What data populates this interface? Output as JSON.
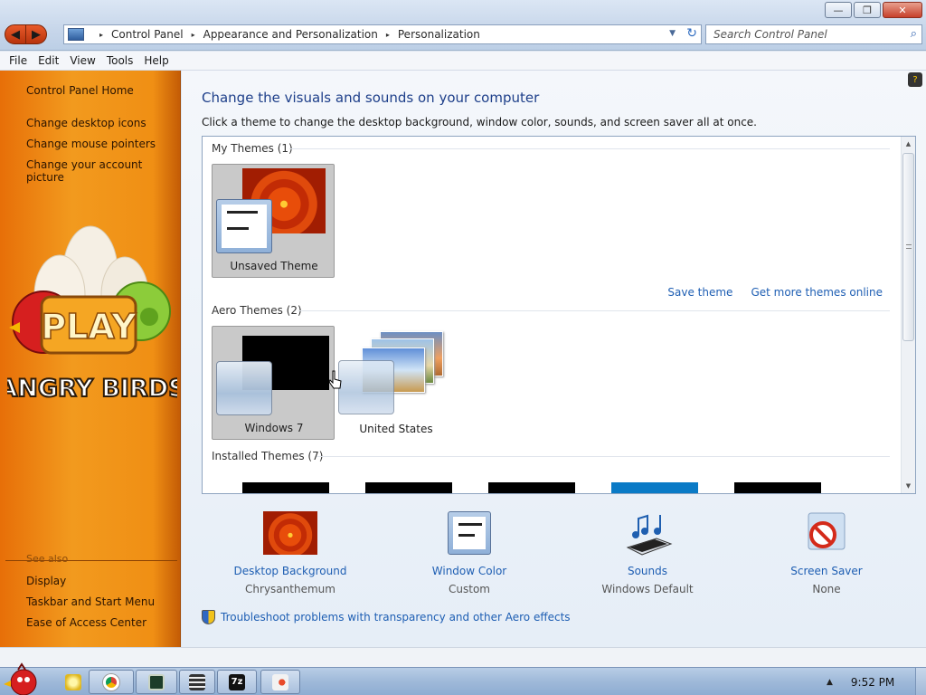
{
  "window": {
    "minimize_glyph": "—",
    "maximize_glyph": "❐",
    "close_glyph": "✕"
  },
  "nav": {
    "back_glyph": "◀",
    "forward_glyph": "▶"
  },
  "address": {
    "crumbs": [
      "Control Panel",
      "Appearance and Personalization",
      "Personalization"
    ],
    "separator": "▸",
    "dropdown_glyph": "▼",
    "refresh_glyph": "↻"
  },
  "search": {
    "placeholder": "Search Control Panel",
    "icon_glyph": "⌕"
  },
  "menu": {
    "items": [
      "File",
      "Edit",
      "View",
      "Tools",
      "Help"
    ]
  },
  "sidebar": {
    "links": [
      "Control Panel Home",
      "Change desktop icons",
      "Change mouse pointers",
      "Change your account picture"
    ],
    "see_also": "See also",
    "see_also_links": [
      "Display",
      "Taskbar and Start Menu",
      "Ease of Access Center"
    ],
    "art": {
      "play_text": "PLAY",
      "logo_text": "ANGRY BIRDS"
    }
  },
  "main": {
    "title": "Change the visuals and sounds on your computer",
    "description": "Click a theme to change the desktop background, window color, sounds, and screen saver all at once.",
    "help_glyph": "?",
    "groups": {
      "my_themes": "My Themes (1)",
      "aero_themes": "Aero Themes (2)",
      "installed_themes": "Installed Themes (7)"
    },
    "themes": {
      "unsaved": "Unsaved Theme",
      "windows7": "Windows 7",
      "united_states": "United States"
    },
    "links": {
      "save_theme": "Save theme",
      "get_more": "Get more themes online"
    },
    "settings": [
      {
        "name": "Desktop Background",
        "value": "Chrysanthemum"
      },
      {
        "name": "Window Color",
        "value": "Custom"
      },
      {
        "name": "Sounds",
        "value": "Windows Default"
      },
      {
        "name": "Screen Saver",
        "value": "None"
      }
    ],
    "troubleshoot": "Troubleshoot problems with transparency and other Aero effects",
    "colors": {
      "accent_link": "#1e5eb3",
      "sidebar_orange": "#f29a1e",
      "installed_strip_blue": "#0a7ac6"
    }
  },
  "taskbar": {
    "items": [
      "angry-birds-start-icon",
      "folder-icon",
      "chrome-icon",
      "monitor-app-icon",
      "calculator-icon",
      "7zip-icon",
      "paint-icon"
    ],
    "tray_arrow": "▲",
    "clock": "9:52 PM",
    "seven_zip_label": "7z"
  }
}
